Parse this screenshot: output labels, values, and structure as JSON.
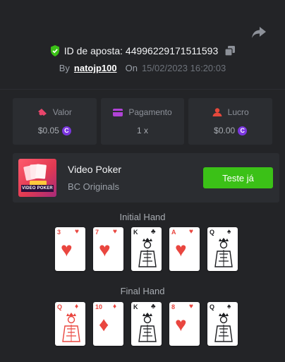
{
  "header": {
    "share_icon": "share-arrow-icon",
    "bet_label": "ID de aposta: 44996229171511593",
    "verified_icon": "shield-check-icon",
    "copy_icon": "copy-icon"
  },
  "meta": {
    "by_label": "By",
    "username": "natojp100",
    "on_label": "On",
    "datetime": "15/02/2023 16:20:03"
  },
  "stats": [
    {
      "label": "Valor",
      "value": "$0.05",
      "icon": "coins-icon",
      "icon_color": "#e8456b",
      "currency_icon": "bc-coin-icon"
    },
    {
      "label": "Pagamento",
      "value": "1 x",
      "icon": "payment-card-icon",
      "icon_color": "#b043d6"
    },
    {
      "label": "Lucro",
      "value": "$0.00",
      "icon": "user-profit-icon",
      "icon_color": "#e5483b",
      "currency_icon": "bc-coin-icon"
    }
  ],
  "game": {
    "title": "Video Poker",
    "provider": "BC Originals",
    "thumbnail_text": "VIDEO POKER",
    "try_button": "Teste já",
    "try_color": "#3bc117"
  },
  "initial_hand": {
    "title": "Initial Hand",
    "cards": [
      {
        "rank": "3",
        "suit": "♥",
        "color": "red",
        "face": false
      },
      {
        "rank": "7",
        "suit": "♥",
        "color": "red",
        "face": false
      },
      {
        "rank": "K",
        "suit": "♣",
        "color": "black",
        "face": true
      },
      {
        "rank": "A",
        "suit": "♥",
        "color": "red",
        "face": false
      },
      {
        "rank": "Q",
        "suit": "♠",
        "color": "black",
        "face": true
      }
    ]
  },
  "final_hand": {
    "title": "Final Hand",
    "cards": [
      {
        "rank": "Q",
        "suit": "♦",
        "color": "red",
        "face": true
      },
      {
        "rank": "10",
        "suit": "♦",
        "color": "red",
        "face": false
      },
      {
        "rank": "K",
        "suit": "♣",
        "color": "black",
        "face": true
      },
      {
        "rank": "8",
        "suit": "♥",
        "color": "red",
        "face": false
      },
      {
        "rank": "Q",
        "suit": "♠",
        "color": "black",
        "face": true
      }
    ]
  }
}
